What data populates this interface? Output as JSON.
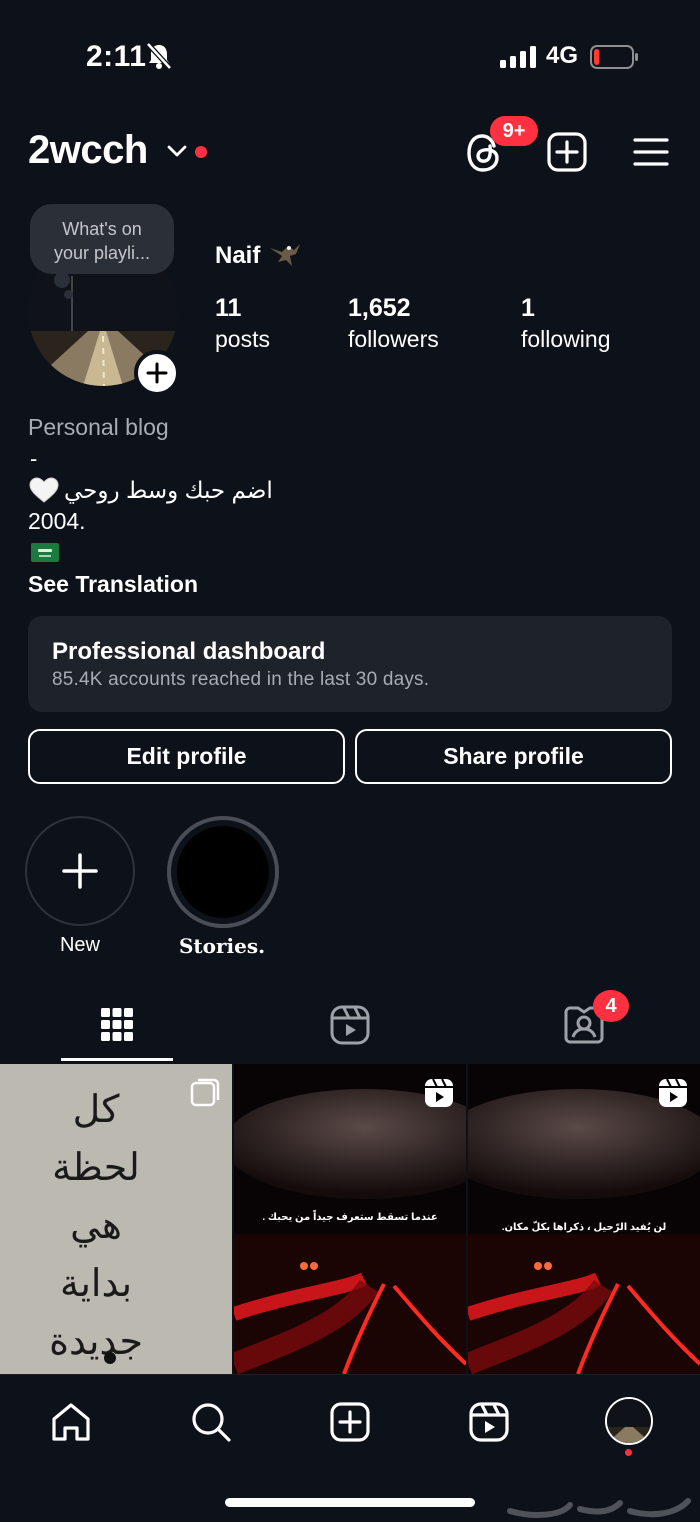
{
  "status_bar": {
    "time": "2:11",
    "network": "4G",
    "battery_level": 0.15,
    "battery_color": "#ff3b30"
  },
  "header": {
    "username": "2wcch",
    "threads_badge": "9+",
    "icons": [
      "chevron-down-icon",
      "threads-icon",
      "create-post-icon",
      "menu-icon"
    ]
  },
  "profile": {
    "note": [
      "What's on",
      "your playli..."
    ],
    "display_name": "Naif",
    "stats": {
      "posts_count": "11",
      "posts_label": "posts",
      "followers_count": "1,652",
      "followers_label": "followers",
      "following_count": "1",
      "following_label": "following"
    },
    "bio": {
      "category": "Personal blog",
      "dash": "-",
      "arabic_line": "اضم حبك وسط روحي",
      "year": "2004.",
      "see_translation": "See Translation"
    }
  },
  "dashboard": {
    "title": "Professional dashboard",
    "subtitle": "85.4K accounts reached in the last 30 days."
  },
  "actions": {
    "edit_profile": "Edit profile",
    "share_profile": "Share profile"
  },
  "highlights": [
    {
      "label": "New"
    },
    {
      "label": "Stories."
    }
  ],
  "tabs": {
    "tagged_badge": "4",
    "items": [
      "grid-tab",
      "reels-tab",
      "tagged-tab"
    ]
  },
  "posts": [
    {
      "lines": [
        "كل",
        "لحظة",
        "هي",
        "بداية",
        "جديدة"
      ],
      "type": "carousel"
    },
    {
      "caption": "عندما تسقط ستعرف جيداً من يحبك .",
      "type": "reel"
    },
    {
      "caption": "لن يُفيد الرّحيل ، ذكراها بكلّ مكان.",
      "type": "reel"
    }
  ],
  "colors": {
    "background": "#0d111a",
    "accent_red": "#ff3040",
    "card": "#1e2229",
    "muted_text": "#a8acb3"
  }
}
